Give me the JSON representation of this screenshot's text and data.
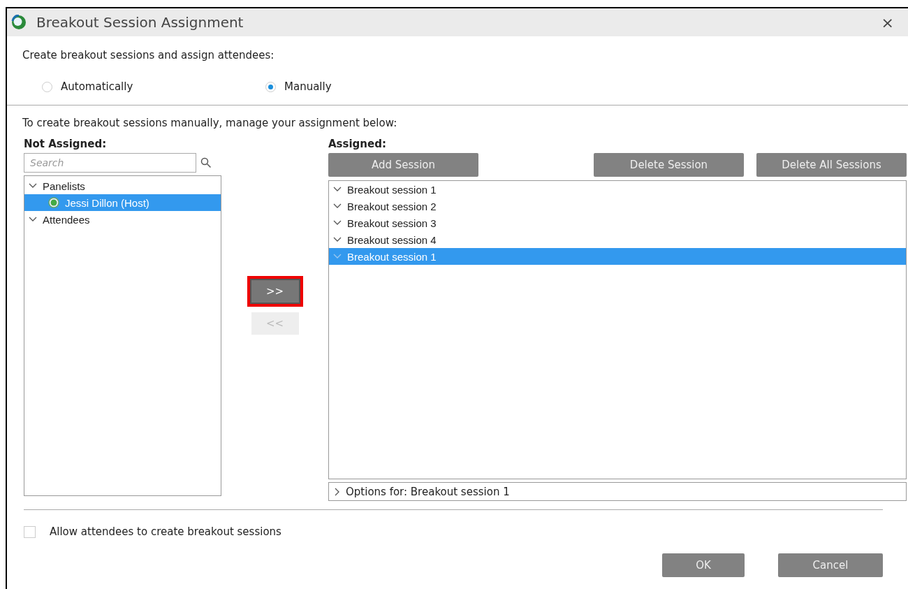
{
  "window": {
    "title": "Breakout Session Assignment",
    "close": "×"
  },
  "intro": "Create breakout sessions and assign attendees:",
  "mode_options": [
    {
      "label": "Automatically",
      "selected": false
    },
    {
      "label": "Manually",
      "selected": true
    }
  ],
  "manual_hint": "To create breakout sessions manually, manage your assignment below:",
  "not_assigned": {
    "heading": "Not Assigned:",
    "search": {
      "placeholder": "Search"
    },
    "tree": [
      {
        "label": "Panelists",
        "expanded": true,
        "selected": false,
        "children": [
          {
            "label": "Jessi Dillon (Host)",
            "selected": true
          }
        ]
      },
      {
        "label": "Attendees",
        "expanded": true,
        "selected": false
      }
    ]
  },
  "transfer_buttons": [
    {
      "label": ">>",
      "disabled": false,
      "highlighted": true
    },
    {
      "label": "<<",
      "disabled": true,
      "highlighted": false
    }
  ],
  "assigned": {
    "heading": "Assigned:",
    "buttons": [
      {
        "label": "Add Session",
        "kind": "left"
      },
      {
        "label": "Delete Session",
        "kind": "right"
      },
      {
        "label": "Delete All Sessions",
        "kind": "right"
      }
    ],
    "sessions": [
      {
        "label": "Breakout session 1",
        "expanded": true,
        "selected": false
      },
      {
        "label": "Breakout session 2",
        "expanded": true,
        "selected": false
      },
      {
        "label": "Breakout session 3",
        "expanded": true,
        "selected": false
      },
      {
        "label": "Breakout session 4",
        "expanded": true,
        "selected": false
      },
      {
        "label": "Breakout session 1",
        "expanded": true,
        "selected": true
      }
    ],
    "options": {
      "label": "Options for: Breakout session 1",
      "expanded": false
    }
  },
  "allow_create": {
    "label": "Allow attendees to create breakout sessions",
    "checked": false
  },
  "footer_buttons": [
    "OK",
    "Cancel"
  ]
}
